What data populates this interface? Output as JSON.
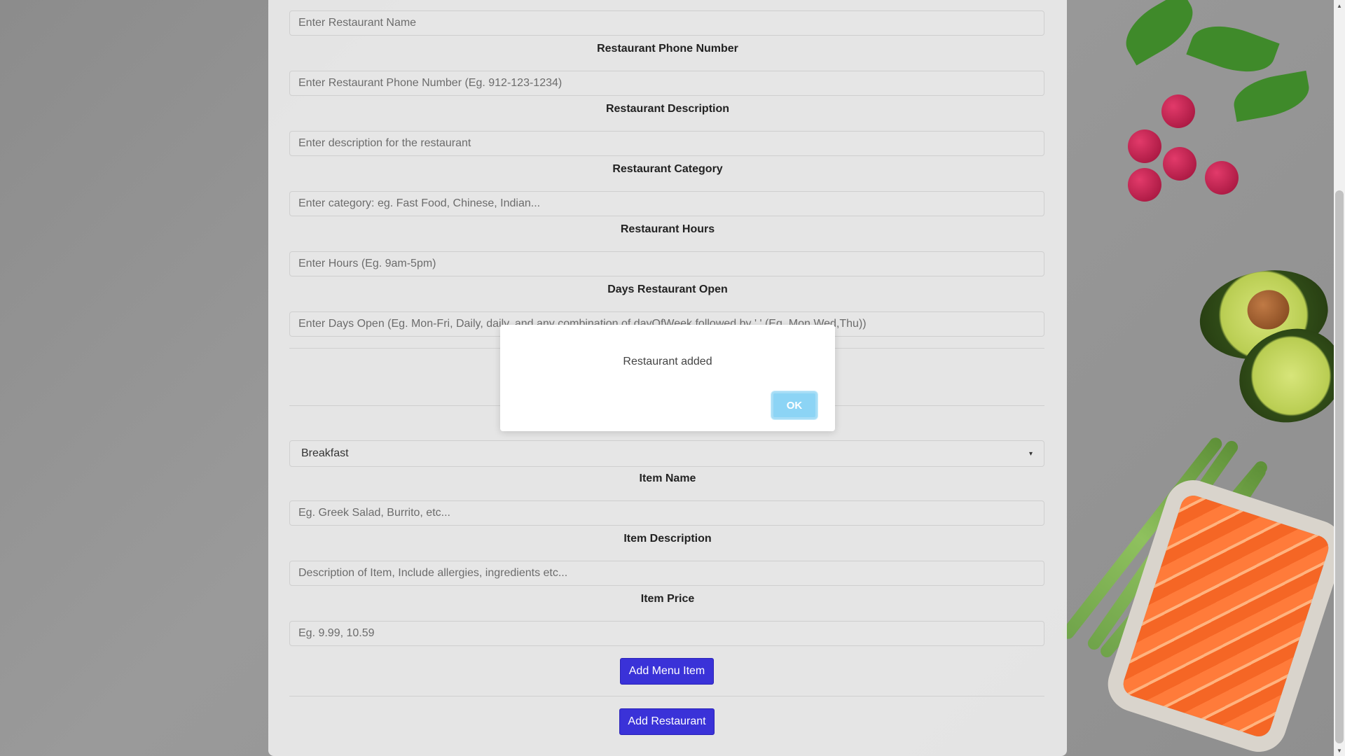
{
  "form": {
    "restaurant_name": {
      "placeholder": "Enter Restaurant Name"
    },
    "phone": {
      "label": "Restaurant Phone Number",
      "placeholder": "Enter Restaurant Phone Number (Eg. 912-123-1234)"
    },
    "description": {
      "label": "Restaurant Description",
      "placeholder": "Enter description for the restaurant"
    },
    "category": {
      "label": "Restaurant Category",
      "placeholder": "Enter category: eg. Fast Food, Chinese, Indian..."
    },
    "hours": {
      "label": "Restaurant Hours",
      "placeholder": "Enter Hours (Eg. 9am-5pm)"
    },
    "days_open": {
      "label": "Days Restaurant Open",
      "placeholder": "Enter Days Open (Eg. Mon-Fri, Daily, daily, and any combination of dayOfWeek followed by ',' (Eg. Mon,Wed,Thu))"
    }
  },
  "menu": {
    "meal_select": {
      "value": "Breakfast"
    },
    "item_name": {
      "label": "Item Name",
      "placeholder": "Eg. Greek Salad, Burrito, etc..."
    },
    "item_description": {
      "label": "Item Description",
      "placeholder": "Description of Item, Include allergies, ingredients etc..."
    },
    "item_price": {
      "label": "Item Price",
      "placeholder": "Eg. 9.99, 10.59"
    },
    "add_item_button": "Add Menu Item"
  },
  "add_restaurant_button": "Add Restaurant",
  "dialog": {
    "message": "Restaurant added",
    "ok_label": "OK"
  },
  "colors": {
    "primary_button": "#3a32d8",
    "ok_button": "#8cd4f5"
  },
  "icons": {
    "select_caret": "▾",
    "scroll_up": "▲",
    "scroll_down": "▼"
  }
}
